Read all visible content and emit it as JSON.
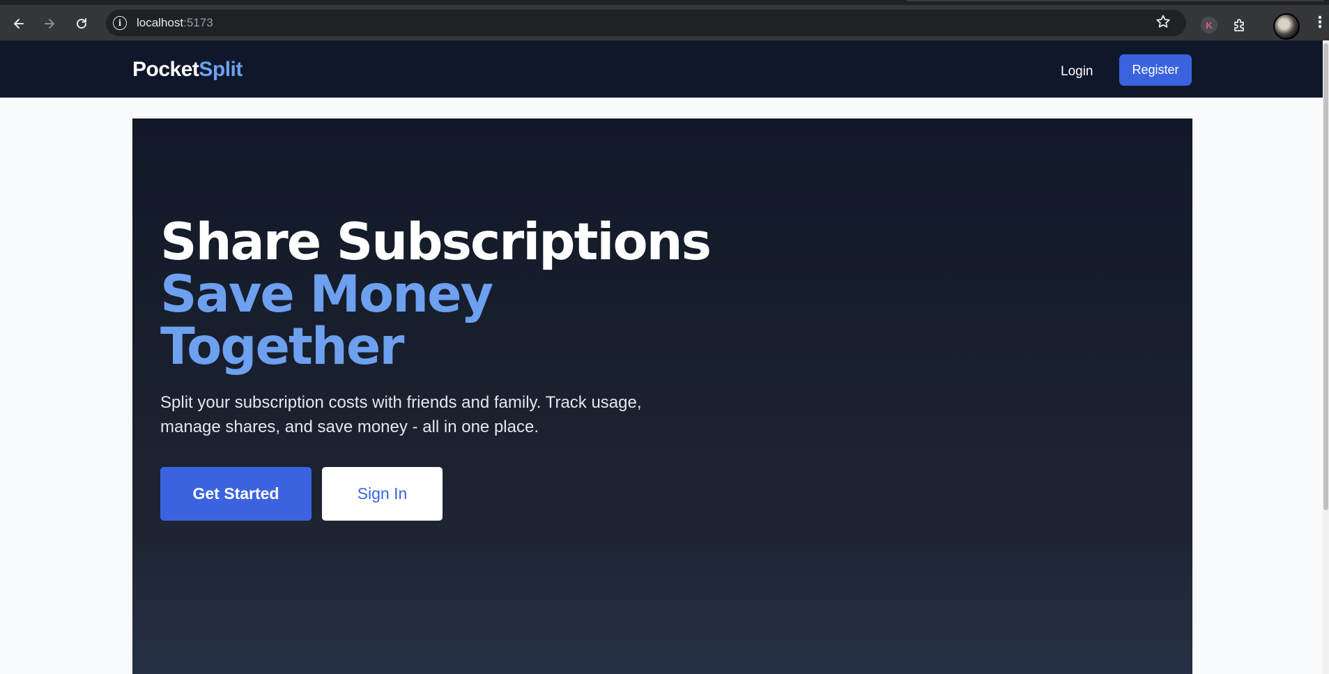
{
  "browser": {
    "url_host": "localhost",
    "url_port": ":5173",
    "back_icon": "arrow-left-icon",
    "forward_icon": "arrow-right-icon",
    "reload_icon": "reload-icon",
    "info_icon": "info-icon",
    "star_icon": "star-icon",
    "extension_k_label": "K",
    "extensions_icon": "puzzle-icon",
    "menu_icon": "more-vert-icon"
  },
  "header": {
    "logo_part1": "Pocket",
    "logo_part2": "Split",
    "login_label": "Login",
    "register_label": "Register"
  },
  "hero": {
    "title_line1": "Share Subscriptions",
    "title_line2": "Save Money",
    "title_line3": "Together",
    "subtitle": "Split your subscription costs with friends and family. Track usage, manage shares, and save money - all in one place.",
    "primary_cta": "Get Started",
    "secondary_cta": "Sign In"
  },
  "colors": {
    "header_bg": "#0f172a",
    "accent_blue": "#3b63e0",
    "title_blue": "#6ea0f0",
    "page_bg": "#f8fafc"
  }
}
